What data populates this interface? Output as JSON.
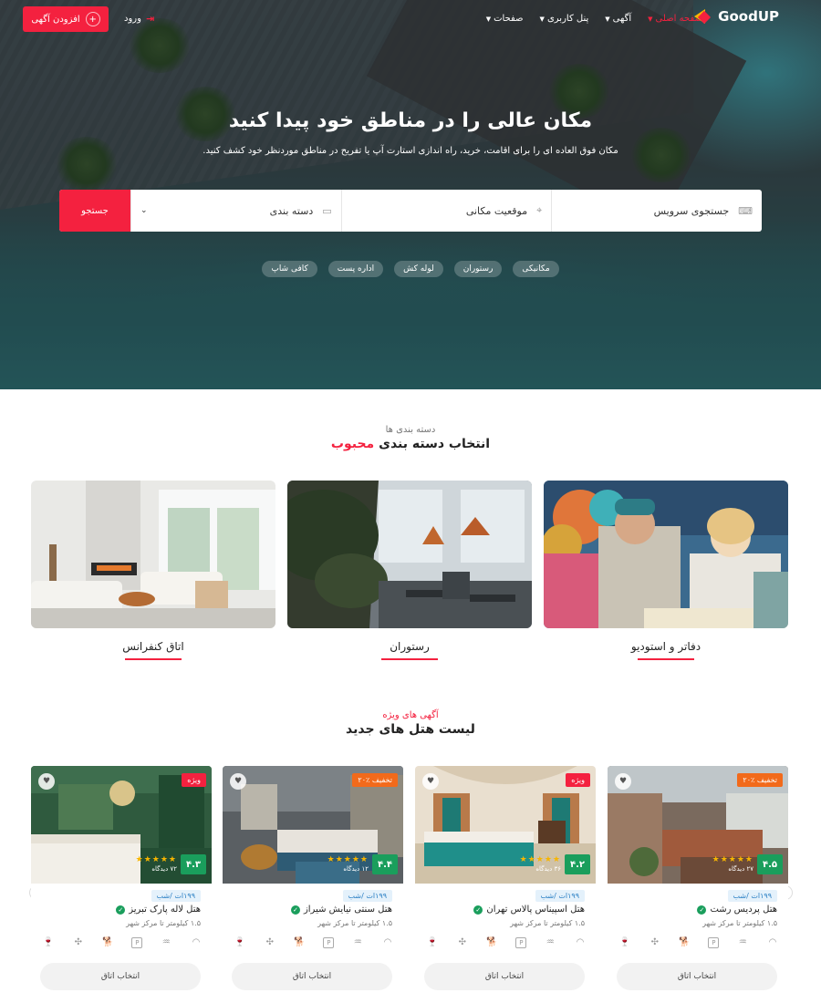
{
  "nav": {
    "logo": "GoodUP",
    "add_listing": "افزودن آگهی",
    "login": "ورود",
    "menu": [
      {
        "label": "صفحه اصلی",
        "active": true
      },
      {
        "label": "آگهی",
        "active": false
      },
      {
        "label": "پنل کاربری",
        "active": false
      },
      {
        "label": "صفحات",
        "active": false
      }
    ]
  },
  "hero": {
    "title": "مکان عالی را در مناطق خود پیدا کنید",
    "subtitle": "مکان فوق العاده ای را برای اقامت، خرید، راه اندازی استارت آپ یا تفریح در مناطق موردنظر خود کشف کنید."
  },
  "search": {
    "service_placeholder": "جستجوی سرویس",
    "location_placeholder": "موقعیت مکانی",
    "category_placeholder": "دسته بندی",
    "button": "جستجو"
  },
  "tags": [
    "مکانیکی",
    "رستوران",
    "لوله کش",
    "اداره پست",
    "کافی شاپ"
  ],
  "categories_section": {
    "kicker": "دسته بندی ها",
    "title_main": "انتخاب دسته بندی",
    "title_accent": "محبوب",
    "items": [
      {
        "label": "دفاتر و استودیو"
      },
      {
        "label": "رستوران"
      },
      {
        "label": "اتاق کنفرانس"
      }
    ]
  },
  "hotels_section": {
    "kicker": "آگهی های ویژه",
    "title": "لیست هتل های جدید",
    "select_label": "انتخاب اتاق",
    "items": [
      {
        "name": "هتل پردیس رشت",
        "price": "۱۹۹ات /شب",
        "distance": "۱.۵ کیلومتر تا مرکز شهر",
        "rating": "۴.۵",
        "views": "۲۷ دیدگاه",
        "badge": "۲۰٪ تخفیف",
        "badge_color": "#f26a1b",
        "rating_value": 4.5
      },
      {
        "name": "هتل اسپیناس پالاس تهران",
        "price": "۱۹۹ات /شب",
        "distance": "۱.۵ کیلومتر تا مرکز شهر",
        "rating": "۴.۲",
        "views": "۳۶ دیدگاه",
        "badge": "ویژه",
        "badge_color": "#f4213f",
        "rating_value": 4.2
      },
      {
        "name": "هتل سنتی نیایش شیراز",
        "price": "۱۹۹ات /شب",
        "distance": "۱.۵ کیلومتر تا مرکز شهر",
        "rating": "۴.۴",
        "views": "۱۲ دیدگاه",
        "badge": "۲۰٪ تخفیف",
        "badge_color": "#f26a1b",
        "rating_value": 4.4
      },
      {
        "name": "هتل لاله پارک تبریز",
        "price": "۱۹۹ات /شب",
        "distance": "۱.۵ کیلومتر تا مرکز شهر",
        "rating": "۴.۳",
        "views": "۷۲ دیدگاه",
        "badge": "ویژه",
        "badge_color": "#f4213f",
        "rating_value": 4.3
      }
    ]
  },
  "colors": {
    "accent": "#f4213f",
    "rating_green": "#1a9e5c",
    "star": "#f7b500"
  }
}
